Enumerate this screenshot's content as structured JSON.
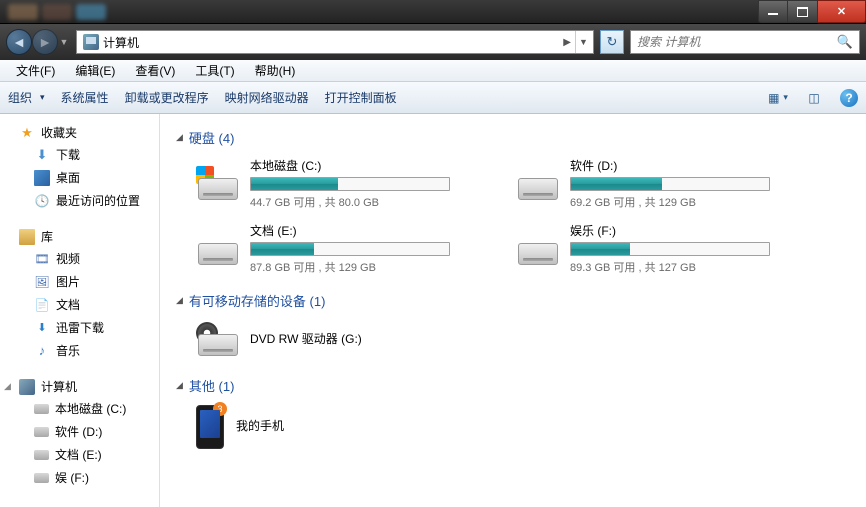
{
  "titlebar": {
    "min": "min",
    "max": "max",
    "close": "close"
  },
  "nav": {
    "location": "计算机",
    "crumb_sep": "▶",
    "refresh": "↻",
    "search_placeholder": "搜索 计算机"
  },
  "menubar": [
    {
      "label": "文件(F)"
    },
    {
      "label": "编辑(E)"
    },
    {
      "label": "查看(V)"
    },
    {
      "label": "工具(T)"
    },
    {
      "label": "帮助(H)"
    }
  ],
  "toolbar": {
    "organize": "组织",
    "items": [
      {
        "label": "系统属性"
      },
      {
        "label": "卸载或更改程序"
      },
      {
        "label": "映射网络驱动器"
      },
      {
        "label": "打开控制面板"
      }
    ]
  },
  "sidebar": {
    "favorites": {
      "label": "收藏夹",
      "items": [
        {
          "label": "下载",
          "icon": "download"
        },
        {
          "label": "桌面",
          "icon": "desktop"
        },
        {
          "label": "最近访问的位置",
          "icon": "recent"
        }
      ]
    },
    "libraries": {
      "label": "库",
      "items": [
        {
          "label": "视频",
          "icon": "video"
        },
        {
          "label": "图片",
          "icon": "picture"
        },
        {
          "label": "文档",
          "icon": "document"
        },
        {
          "label": "迅雷下载",
          "icon": "thunder"
        },
        {
          "label": "音乐",
          "icon": "music"
        }
      ]
    },
    "computer": {
      "label": "计算机",
      "items": [
        {
          "label": "本地磁盘 (C:)",
          "sys": true
        },
        {
          "label": "软件 (D:)",
          "sys": false
        },
        {
          "label": "文档 (E:)",
          "sys": false
        },
        {
          "label": "娱 (F:)",
          "sys": false
        }
      ]
    }
  },
  "sections": {
    "hdd": {
      "title": "硬盘 (4)",
      "drives": [
        {
          "name": "本地磁盘 (C:)",
          "stat": "44.7 GB 可用 , 共 80.0 GB",
          "fill_pct": 44,
          "win": true
        },
        {
          "name": "软件 (D:)",
          "stat": "69.2 GB 可用 , 共 129 GB",
          "fill_pct": 46,
          "win": false
        },
        {
          "name": "文档 (E:)",
          "stat": "87.8 GB 可用 , 共 129 GB",
          "fill_pct": 32,
          "win": false
        },
        {
          "name": "娱乐 (F:)",
          "stat": "89.3 GB 可用 , 共 127 GB",
          "fill_pct": 30,
          "win": false
        }
      ]
    },
    "removable": {
      "title": "有可移动存储的设备 (1)",
      "devices": [
        {
          "name": "DVD RW 驱动器 (G:)",
          "kind": "dvd"
        }
      ]
    },
    "other": {
      "title": "其他 (1)",
      "devices": [
        {
          "name": "我的手机",
          "badge": "3",
          "kind": "phone"
        }
      ]
    }
  }
}
